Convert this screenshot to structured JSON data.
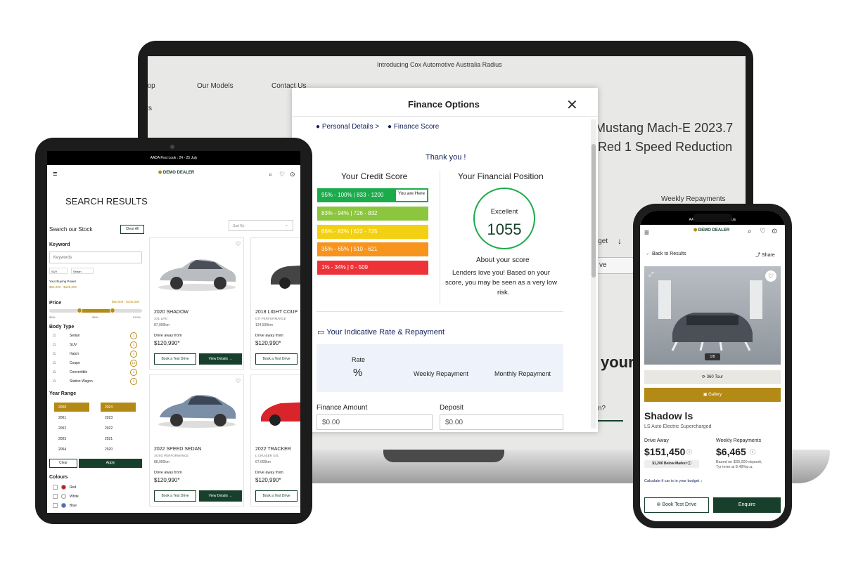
{
  "colors": {
    "green": "#17402c",
    "gold": "#b48a16",
    "navy": "#12205a"
  },
  "laptop": {
    "banner": "Introducing Cox Automotive Australia Radius",
    "nav": [
      "hop",
      "Our Models",
      "Contact Us"
    ],
    "nav_sub": "lts",
    "car_title_1": "Mustang Mach-E 2023.7",
    "car_title_2": "Red 1 Speed Reduction",
    "weekly_label": "Weekly Repayments",
    "budget": "lget",
    "ve": "ve",
    "your": "your",
    "q": "n?"
  },
  "modal": {
    "title": "Finance Options",
    "steps": [
      "Personal Details >",
      "Finance Score"
    ],
    "thanks": "Thank you !",
    "credit_title": "Your Credit Score",
    "score_rows": [
      {
        "label": "95% - 100% | 833 - 1200",
        "color": "#1bab4b"
      },
      {
        "label": "83% - 94% | 726 - 832",
        "color": "#8cc63f"
      },
      {
        "label": "66% - 82% | 622 - 725",
        "color": "#f4d015"
      },
      {
        "label": "35% - 65% | 510 - 621",
        "color": "#f7941d"
      },
      {
        "label": "1% - 34% | 0 - 509",
        "color": "#ee3338"
      }
    ],
    "you_are_here": "You are Here",
    "fin_title": "Your Financial Position",
    "rating": "Excellent",
    "score": "1055",
    "about_title": "About your score",
    "about_text": [
      "Lenders love you! Based on your",
      "score, you may be seen as a very low",
      "risk."
    ],
    "rate_title": "Your Indicative Rate & Repayment",
    "rate_label": "Rate",
    "rate_value": "%",
    "weekly": "Weekly Repayment",
    "monthly": "Monthly Repayment",
    "finance_amount_label": "Finance Amount",
    "finance_amount_value": "$0.00",
    "deposit_label": "Deposit",
    "deposit_value": "$0.00"
  },
  "tablet": {
    "promo": "AADA First Look : 24 - 25 July",
    "logo": "DEMO DEALER",
    "heading": "SEARCH RESULTS",
    "sort": "Sort By",
    "search_stock": "Search our Stock",
    "clear_all": "Clear All",
    "keyword_label": "Keyword",
    "keyword_placeholder": "Keywords",
    "chips": [
      "SUV",
      "Sedan"
    ],
    "buying_power": "Your Buying Power",
    "buying_range": "$60,000 - $125,000",
    "price_label": "Price",
    "price_range": "$60,000 - $100,000",
    "price_ticks": [
      "$50k",
      "$80k",
      "$100k"
    ],
    "body_type": "Body Type",
    "body_items": [
      {
        "name": "Sedan",
        "count": "1"
      },
      {
        "name": "SUV",
        "count": "1"
      },
      {
        "name": "Hatch",
        "count": "1"
      },
      {
        "name": "Coupe",
        "count": "13"
      },
      {
        "name": "Convertible",
        "count": "1"
      },
      {
        "name": "Station Wagon",
        "count": "4"
      }
    ],
    "year_range": "Year Range",
    "years_from": [
      "2000",
      "2001",
      "2002",
      "2003",
      "2004"
    ],
    "years_to": [
      "2024",
      "2023",
      "2022",
      "2021",
      "2020"
    ],
    "clear": "Clear",
    "apply": "Apply",
    "colours": "Colours",
    "colour_items": [
      {
        "name": "Red",
        "color": "#c8171c"
      },
      {
        "name": "White",
        "color": "#ffffff"
      },
      {
        "name": "Blue",
        "color": "#3c6fc7"
      }
    ],
    "cards": [
      {
        "title": "2020 SHADOW",
        "sub": "XXL LIFE",
        "km": "87,000km",
        "drive": "Drive away from",
        "price": "$120,990*"
      },
      {
        "title": "2018 LIGHT COUP",
        "sub": "GTI PERFORMANCE",
        "km": "124,500km",
        "drive": "Drive away from",
        "price": "$120,990*"
      },
      {
        "title": "2022 SPEED SEDAN",
        "sub": "XOXO PERFORMANCE",
        "km": "88,000km",
        "drive": "Drive away from",
        "price": "$120,990*"
      },
      {
        "title": "2022 TRACKER",
        "sub": "L CRUISER XXL",
        "km": "67,000km",
        "drive": "Drive away from",
        "price": "$120,990*"
      }
    ],
    "book": "Book a Test Drive",
    "view": "View Details"
  },
  "phone": {
    "promo": "AADA First Look : 24 - 25 July",
    "logo": "DEMO DEALER",
    "back": "Back to Results",
    "share": "Share",
    "counter": "1/8",
    "tour": "360 Tour",
    "gallery": "Gallery",
    "title": "Shadow ls",
    "subtitle": "LS Auto Electric Supercharged",
    "drive_away": "Drive Away",
    "price": "$151,450",
    "below_market": "$1,200 Below Market",
    "weekly": "Weekly Repayments",
    "weekly_value": "$6,465",
    "weekly_note1": "Based on $30,000 deposit,",
    "weekly_note2": "7yr term at 8.49%p.a.",
    "calc": "Calculate if car is in your budget",
    "book": "Book Test Drive",
    "enquire": "Enquire"
  }
}
